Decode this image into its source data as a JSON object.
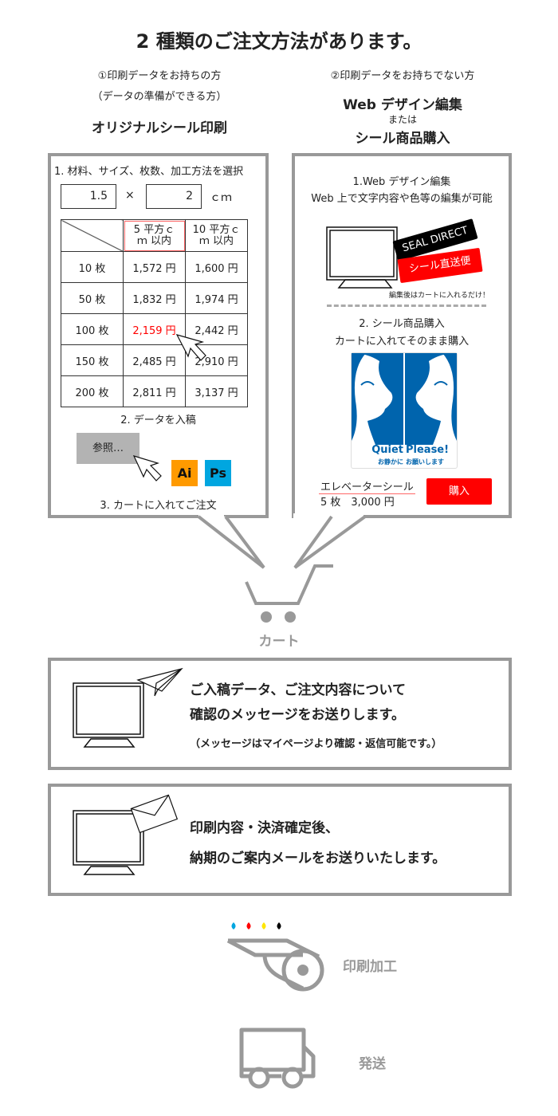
{
  "title": "2 種類のご注文方法があります。",
  "left": {
    "sub1": "①印刷データをお持ちの方",
    "sub2": "（データの準備ができる方）",
    "heading": "オリジナルシール印刷",
    "step1": "1. 材料、サイズ、枚数、加工方法を選択",
    "width_value": "1.5",
    "times": "×",
    "height_value": "2",
    "unit": "ｃｍ",
    "table": {
      "headers": [
        "5 平方ｃｍ 以内",
        "10 平方ｃｍ 以内"
      ],
      "rows": [
        [
          "10 枚",
          "1,572 円",
          "1,600 円"
        ],
        [
          "50 枚",
          "1,832 円",
          "1,974 円"
        ],
        [
          "100 枚",
          "2,159 円",
          "2,442 円"
        ],
        [
          "150 枚",
          "2,485 円",
          "2,910 円"
        ],
        [
          "200 枚",
          "2,811 円",
          "3,137 円"
        ]
      ]
    },
    "step2": "2. データを入稿",
    "browse": "参照…",
    "ai": "Ai",
    "ps": "Ps",
    "step3": "3. カートに入れてご注文"
  },
  "right": {
    "sub1": "②印刷データをお持ちでない方",
    "heading1": "Web デザイン編集",
    "or": "または",
    "heading2": "シール商品購入",
    "step1a": "1.Web デザイン編集",
    "step1b": "Web 上で文字内容や色等の編集が可能",
    "badge1": "SEAL DIRECT",
    "badge2": "シール直送便",
    "note": "編集後はカートに入れるだけ！",
    "step2a": "2. シール商品購入",
    "step2b": "カートに入れてそのまま購入",
    "sticker_left": "Quiet",
    "sticker_left_jp": "お静かに",
    "sticker_right": "Please!",
    "sticker_right_jp": "お願いします",
    "product": "エレベーターシール",
    "product_qty": "5 枚　3,000 円",
    "buy": "購入"
  },
  "cart": "カート",
  "msg1": {
    "line1": "ご入稿データ、ご注文内容について",
    "line2": "確認のメッセージをお送りします。",
    "line3": "（メッセージはマイページより確認・返信可能です。）"
  },
  "msg2": {
    "line1": "印刷内容・決済確定後、",
    "line2": "納期のご案内メールをお送りいたします。"
  },
  "print": "印刷加工",
  "ship": "発送",
  "colors": {
    "border": "#999999",
    "red": "#ff0000",
    "blue": "#0064ad",
    "ai": "#ff9a00",
    "ps": "#00a6e0"
  }
}
